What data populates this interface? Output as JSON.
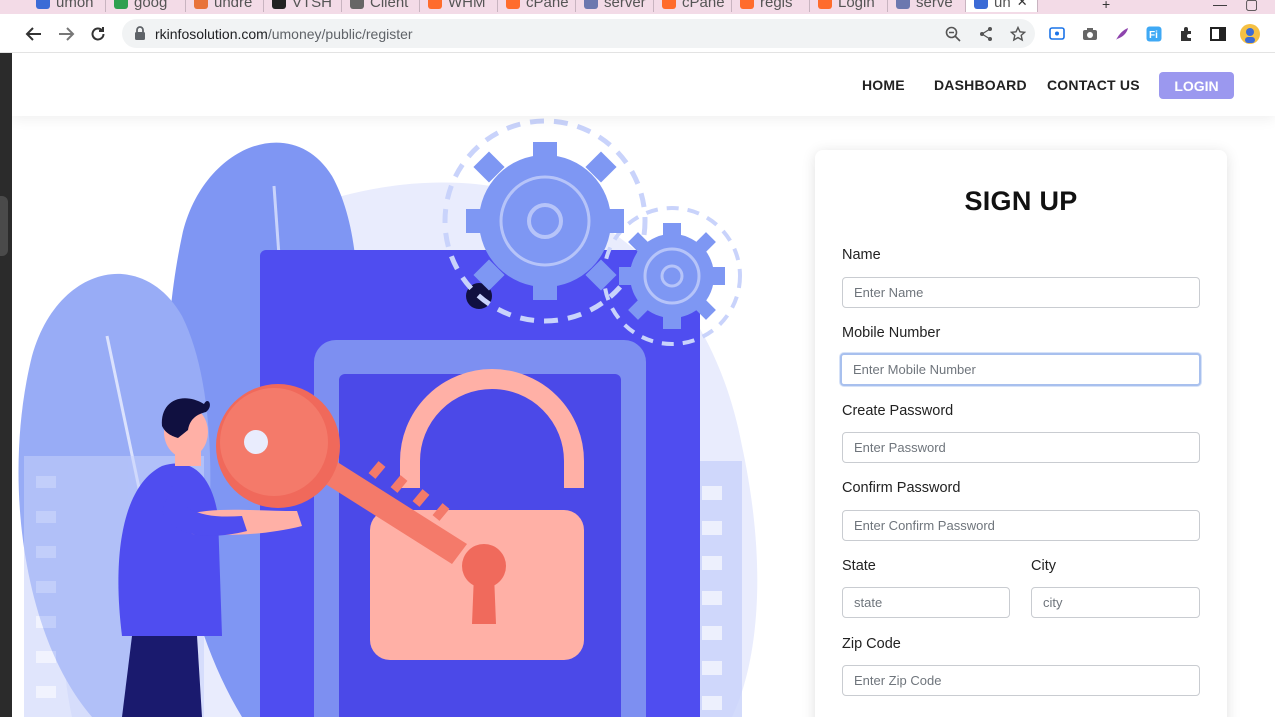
{
  "browser": {
    "tabs": [
      {
        "label": "umon",
        "color": "#3b6bd6"
      },
      {
        "label": "goog",
        "color": "#2ea04f"
      },
      {
        "label": "undre",
        "color": "#e8743b"
      },
      {
        "label": "VTSH",
        "color": "#222222"
      },
      {
        "label": "Client",
        "color": "#666666"
      },
      {
        "label": "WHM",
        "color": "#ff6c2c"
      },
      {
        "label": "cPane",
        "color": "#ff6c2c"
      },
      {
        "label": "server",
        "color": "#6c78af"
      },
      {
        "label": "cPane",
        "color": "#ff6c2c"
      },
      {
        "label": "regis",
        "color": "#ff6c2c"
      },
      {
        "label": "Login",
        "color": "#ff6c2c"
      },
      {
        "label": "serve",
        "color": "#6c78af"
      },
      {
        "label": "un",
        "color": "#3b6bd6"
      }
    ],
    "url_host": "rkinfosolution.com",
    "url_path": "/umoney/public/register"
  },
  "nav": {
    "home": "HOME",
    "dashboard": "DASHBOARD",
    "contact": "CONTACT US",
    "login": "LOGIN"
  },
  "form": {
    "title": "SIGN UP",
    "name_label": "Name",
    "name_placeholder": "Enter Name",
    "mobile_label": "Mobile Number",
    "mobile_placeholder": "Enter Mobile Number",
    "password_label": "Create Password",
    "password_placeholder": "Enter Password",
    "confirm_label": "Confirm Password",
    "confirm_placeholder": "Enter Confirm Password",
    "state_label": "State",
    "state_placeholder": "state",
    "city_label": "City",
    "city_placeholder": "city",
    "zip_label": "Zip Code",
    "zip_placeholder": "Enter Zip Code"
  },
  "colors": {
    "accent": "#9b98ef",
    "illustration_primary": "#4f4df0",
    "key": "#f47a6a",
    "lock": "#ffb0a6"
  }
}
